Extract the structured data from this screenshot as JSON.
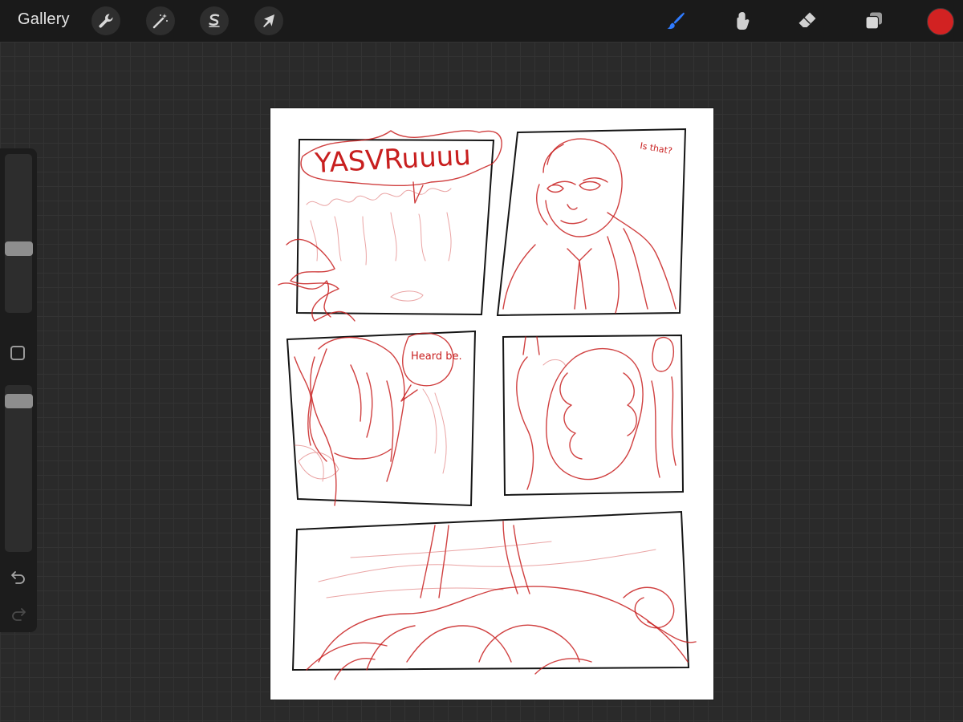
{
  "topbar": {
    "gallery_label": "Gallery",
    "left_tools": [
      {
        "name": "actions",
        "icon": "wrench-icon"
      },
      {
        "name": "adjustments",
        "icon": "magic-wand-icon"
      },
      {
        "name": "selection",
        "icon": "selection-s-icon"
      },
      {
        "name": "transform",
        "icon": "arrow-cursor-icon"
      }
    ],
    "right_tools": [
      {
        "name": "brush",
        "icon": "brush-icon",
        "active": true
      },
      {
        "name": "smudge",
        "icon": "smudge-icon"
      },
      {
        "name": "eraser",
        "icon": "eraser-icon"
      },
      {
        "name": "layers",
        "icon": "layers-icon"
      }
    ],
    "current_color": "#d22222",
    "active_tool_color": "#2f7bff"
  },
  "sidebar": {
    "brush_size_level": 0.33,
    "opacity_level": 0.95,
    "undo_icon": "undo-icon",
    "redo_icon": "redo-icon"
  },
  "canvas": {
    "sketch_texts": {
      "sfx": "YASVRuuuu",
      "speech": "Heard be.",
      "thought": "Is that?"
    }
  }
}
